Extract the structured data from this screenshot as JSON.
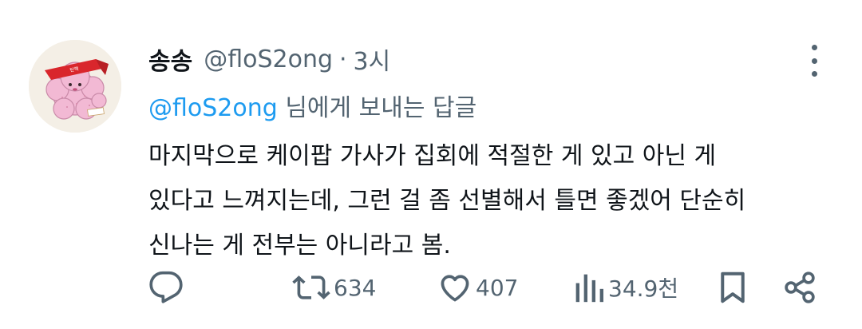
{
  "tweet": {
    "display_name": "송송",
    "handle": "@floS2ong",
    "separator": "·",
    "time": "3시",
    "reply_to_handle": "@floS2ong",
    "reply_to_suffix": " 님에게 보내는 답글",
    "body_lines": [
      "마지막으로 케이팝 가사가 집회에 적절한 게 있고 아닌 게",
      "있다고 느껴지는데, 그런 걸 좀 선별해서 틀면 좋겠어 단순히",
      "신나는 게 전부는 아니라고 봄."
    ]
  },
  "actions": {
    "reply_icon": "reply-icon",
    "retweet_icon": "retweet-icon",
    "retweet_count": "634",
    "like_icon": "heart-icon",
    "like_count": "407",
    "views_icon": "views-icon",
    "views_count": "34.9천",
    "bookmark_icon": "bookmark-icon",
    "share_icon": "share-icon"
  },
  "colors": {
    "text_primary": "#0f1419",
    "text_secondary": "#536471",
    "link": "#1d9bf0",
    "avatar_headband": "#d9262c",
    "avatar_body": "#f2b9d4"
  }
}
